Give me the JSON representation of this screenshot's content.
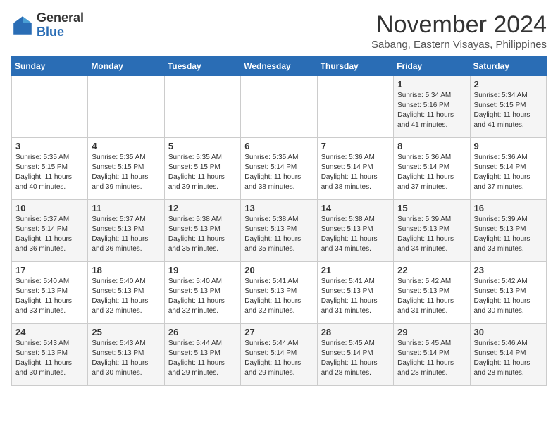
{
  "logo": {
    "general": "General",
    "blue": "Blue"
  },
  "title": "November 2024",
  "location": "Sabang, Eastern Visayas, Philippines",
  "days_of_week": [
    "Sunday",
    "Monday",
    "Tuesday",
    "Wednesday",
    "Thursday",
    "Friday",
    "Saturday"
  ],
  "weeks": [
    [
      {
        "day": "",
        "sunrise": "",
        "sunset": "",
        "daylight": ""
      },
      {
        "day": "",
        "sunrise": "",
        "sunset": "",
        "daylight": ""
      },
      {
        "day": "",
        "sunrise": "",
        "sunset": "",
        "daylight": ""
      },
      {
        "day": "",
        "sunrise": "",
        "sunset": "",
        "daylight": ""
      },
      {
        "day": "",
        "sunrise": "",
        "sunset": "",
        "daylight": ""
      },
      {
        "day": "1",
        "sunrise": "Sunrise: 5:34 AM",
        "sunset": "Sunset: 5:16 PM",
        "daylight": "Daylight: 11 hours and 41 minutes."
      },
      {
        "day": "2",
        "sunrise": "Sunrise: 5:34 AM",
        "sunset": "Sunset: 5:15 PM",
        "daylight": "Daylight: 11 hours and 41 minutes."
      }
    ],
    [
      {
        "day": "3",
        "sunrise": "Sunrise: 5:35 AM",
        "sunset": "Sunset: 5:15 PM",
        "daylight": "Daylight: 11 hours and 40 minutes."
      },
      {
        "day": "4",
        "sunrise": "Sunrise: 5:35 AM",
        "sunset": "Sunset: 5:15 PM",
        "daylight": "Daylight: 11 hours and 39 minutes."
      },
      {
        "day": "5",
        "sunrise": "Sunrise: 5:35 AM",
        "sunset": "Sunset: 5:15 PM",
        "daylight": "Daylight: 11 hours and 39 minutes."
      },
      {
        "day": "6",
        "sunrise": "Sunrise: 5:35 AM",
        "sunset": "Sunset: 5:14 PM",
        "daylight": "Daylight: 11 hours and 38 minutes."
      },
      {
        "day": "7",
        "sunrise": "Sunrise: 5:36 AM",
        "sunset": "Sunset: 5:14 PM",
        "daylight": "Daylight: 11 hours and 38 minutes."
      },
      {
        "day": "8",
        "sunrise": "Sunrise: 5:36 AM",
        "sunset": "Sunset: 5:14 PM",
        "daylight": "Daylight: 11 hours and 37 minutes."
      },
      {
        "day": "9",
        "sunrise": "Sunrise: 5:36 AM",
        "sunset": "Sunset: 5:14 PM",
        "daylight": "Daylight: 11 hours and 37 minutes."
      }
    ],
    [
      {
        "day": "10",
        "sunrise": "Sunrise: 5:37 AM",
        "sunset": "Sunset: 5:14 PM",
        "daylight": "Daylight: 11 hours and 36 minutes."
      },
      {
        "day": "11",
        "sunrise": "Sunrise: 5:37 AM",
        "sunset": "Sunset: 5:13 PM",
        "daylight": "Daylight: 11 hours and 36 minutes."
      },
      {
        "day": "12",
        "sunrise": "Sunrise: 5:38 AM",
        "sunset": "Sunset: 5:13 PM",
        "daylight": "Daylight: 11 hours and 35 minutes."
      },
      {
        "day": "13",
        "sunrise": "Sunrise: 5:38 AM",
        "sunset": "Sunset: 5:13 PM",
        "daylight": "Daylight: 11 hours and 35 minutes."
      },
      {
        "day": "14",
        "sunrise": "Sunrise: 5:38 AM",
        "sunset": "Sunset: 5:13 PM",
        "daylight": "Daylight: 11 hours and 34 minutes."
      },
      {
        "day": "15",
        "sunrise": "Sunrise: 5:39 AM",
        "sunset": "Sunset: 5:13 PM",
        "daylight": "Daylight: 11 hours and 34 minutes."
      },
      {
        "day": "16",
        "sunrise": "Sunrise: 5:39 AM",
        "sunset": "Sunset: 5:13 PM",
        "daylight": "Daylight: 11 hours and 33 minutes."
      }
    ],
    [
      {
        "day": "17",
        "sunrise": "Sunrise: 5:40 AM",
        "sunset": "Sunset: 5:13 PM",
        "daylight": "Daylight: 11 hours and 33 minutes."
      },
      {
        "day": "18",
        "sunrise": "Sunrise: 5:40 AM",
        "sunset": "Sunset: 5:13 PM",
        "daylight": "Daylight: 11 hours and 32 minutes."
      },
      {
        "day": "19",
        "sunrise": "Sunrise: 5:40 AM",
        "sunset": "Sunset: 5:13 PM",
        "daylight": "Daylight: 11 hours and 32 minutes."
      },
      {
        "day": "20",
        "sunrise": "Sunrise: 5:41 AM",
        "sunset": "Sunset: 5:13 PM",
        "daylight": "Daylight: 11 hours and 32 minutes."
      },
      {
        "day": "21",
        "sunrise": "Sunrise: 5:41 AM",
        "sunset": "Sunset: 5:13 PM",
        "daylight": "Daylight: 11 hours and 31 minutes."
      },
      {
        "day": "22",
        "sunrise": "Sunrise: 5:42 AM",
        "sunset": "Sunset: 5:13 PM",
        "daylight": "Daylight: 11 hours and 31 minutes."
      },
      {
        "day": "23",
        "sunrise": "Sunrise: 5:42 AM",
        "sunset": "Sunset: 5:13 PM",
        "daylight": "Daylight: 11 hours and 30 minutes."
      }
    ],
    [
      {
        "day": "24",
        "sunrise": "Sunrise: 5:43 AM",
        "sunset": "Sunset: 5:13 PM",
        "daylight": "Daylight: 11 hours and 30 minutes."
      },
      {
        "day": "25",
        "sunrise": "Sunrise: 5:43 AM",
        "sunset": "Sunset: 5:13 PM",
        "daylight": "Daylight: 11 hours and 30 minutes."
      },
      {
        "day": "26",
        "sunrise": "Sunrise: 5:44 AM",
        "sunset": "Sunset: 5:13 PM",
        "daylight": "Daylight: 11 hours and 29 minutes."
      },
      {
        "day": "27",
        "sunrise": "Sunrise: 5:44 AM",
        "sunset": "Sunset: 5:14 PM",
        "daylight": "Daylight: 11 hours and 29 minutes."
      },
      {
        "day": "28",
        "sunrise": "Sunrise: 5:45 AM",
        "sunset": "Sunset: 5:14 PM",
        "daylight": "Daylight: 11 hours and 28 minutes."
      },
      {
        "day": "29",
        "sunrise": "Sunrise: 5:45 AM",
        "sunset": "Sunset: 5:14 PM",
        "daylight": "Daylight: 11 hours and 28 minutes."
      },
      {
        "day": "30",
        "sunrise": "Sunrise: 5:46 AM",
        "sunset": "Sunset: 5:14 PM",
        "daylight": "Daylight: 11 hours and 28 minutes."
      }
    ]
  ]
}
